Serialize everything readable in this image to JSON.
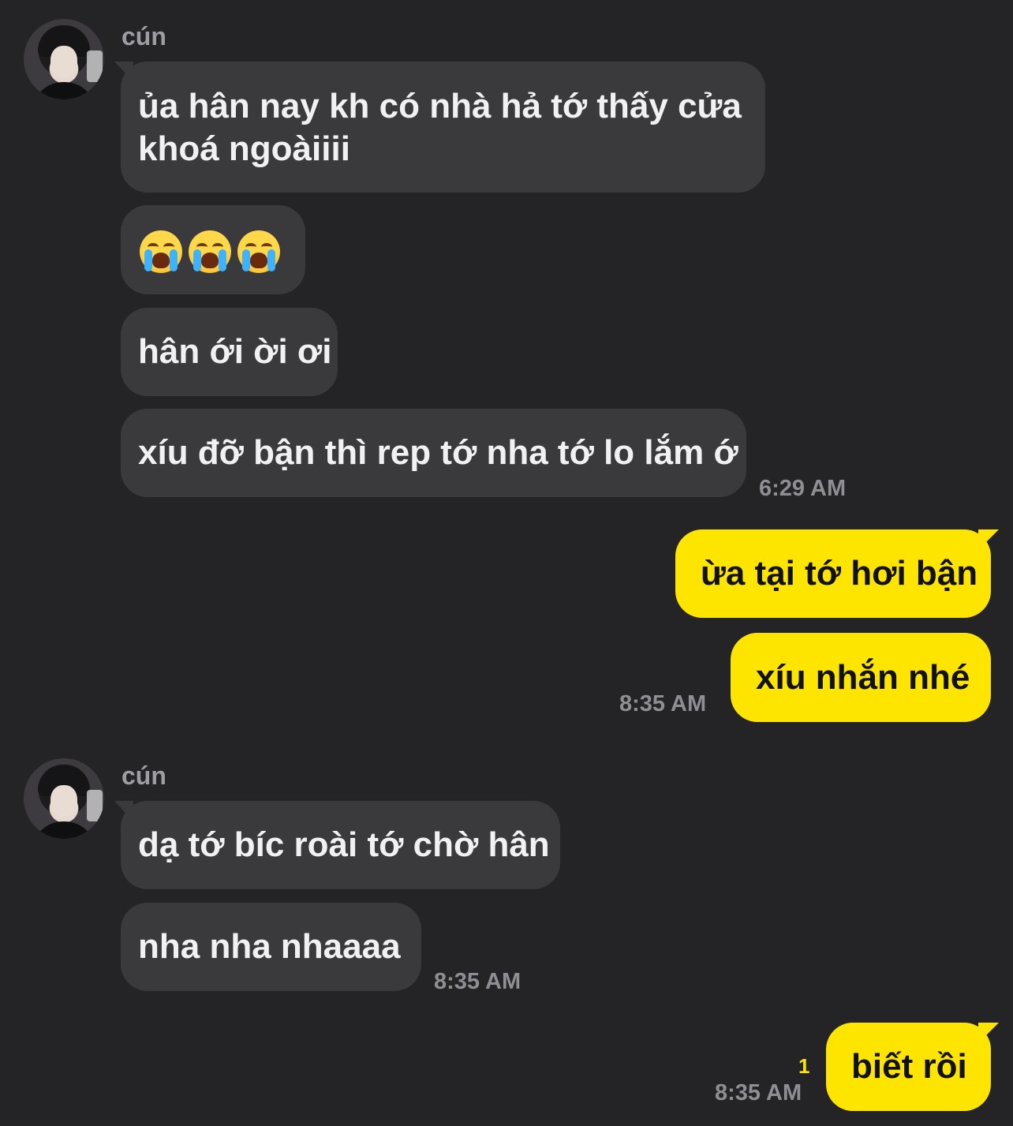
{
  "chat": {
    "group1": {
      "sender": "cún",
      "messages": [
        "ủa hân nay kh có nhà hả tớ thấy cửa",
        "khoá ngoàiiii",
        "hân ới ời ơi",
        "xíu đỡ bận thì rep tớ nha tớ lo lắm ớ"
      ],
      "emoji_message": [
        "loudly-crying-face",
        "loudly-crying-face",
        "loudly-crying-face"
      ],
      "time": "6:29 AM"
    },
    "group2": {
      "messages": [
        "ừa tại tớ hơi bận",
        "xíu nhắn nhé"
      ],
      "time": "8:35 AM"
    },
    "group3": {
      "sender": "cún",
      "messages": [
        "dạ tớ bíc roài tớ chờ hân",
        "nha nha nhaaaa"
      ],
      "time": "8:35 AM"
    },
    "group4": {
      "messages": [
        "biết rồi"
      ],
      "unread_count": "1",
      "time": "8:35 AM"
    }
  },
  "colors": {
    "background": "#242426",
    "incoming_bubble": "#3a3a3d",
    "outgoing_bubble": "#fee500"
  }
}
